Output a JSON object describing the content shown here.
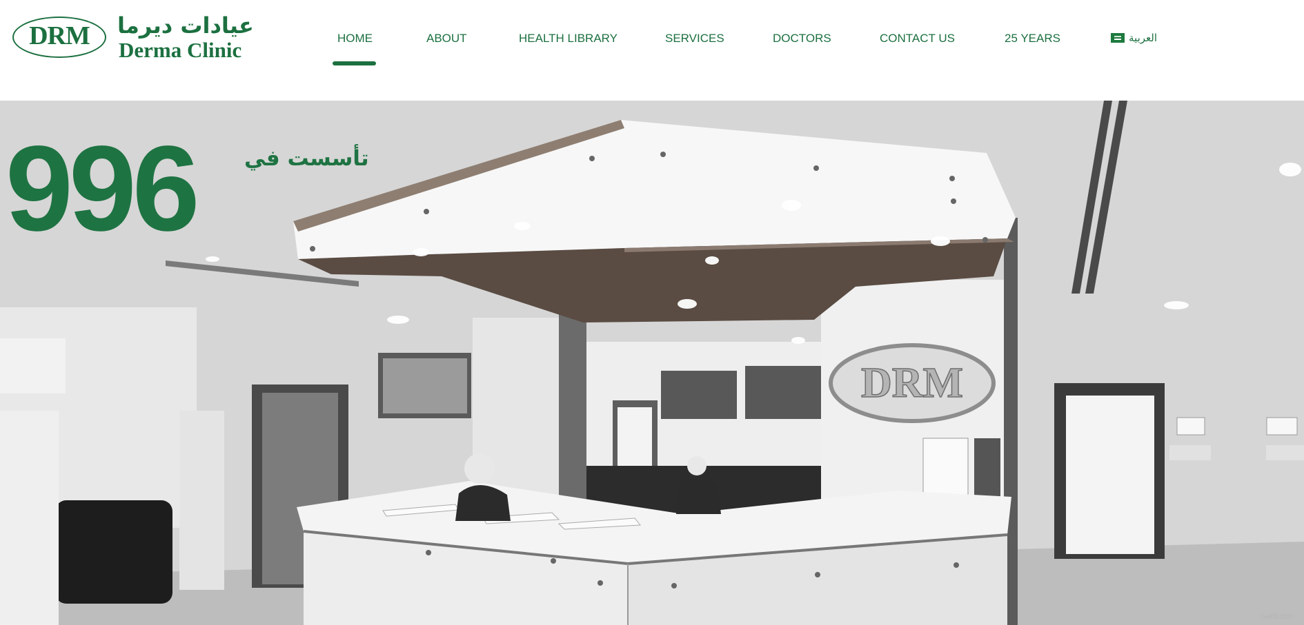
{
  "logo": {
    "monogram": "DRM",
    "arabic_name": "عيادات ديرما",
    "english_name": "Derma Clinic"
  },
  "nav": {
    "items": [
      {
        "label": "HOME",
        "active": true
      },
      {
        "label": "ABOUT"
      },
      {
        "label": "HEALTH LIBRARY"
      },
      {
        "label": "SERVICES"
      },
      {
        "label": "DOCTORS"
      },
      {
        "label": "CONTACT US"
      },
      {
        "label": "25 YEARS"
      }
    ],
    "language": {
      "label": "العربية",
      "icon": "saudi-flag-icon"
    }
  },
  "hero": {
    "founded_label": "تأسست في",
    "year": "996",
    "sign_text": "DRM",
    "watermark": "GetButton"
  },
  "colors": {
    "brand_green": "#1c7040",
    "background": "#ffffff"
  }
}
